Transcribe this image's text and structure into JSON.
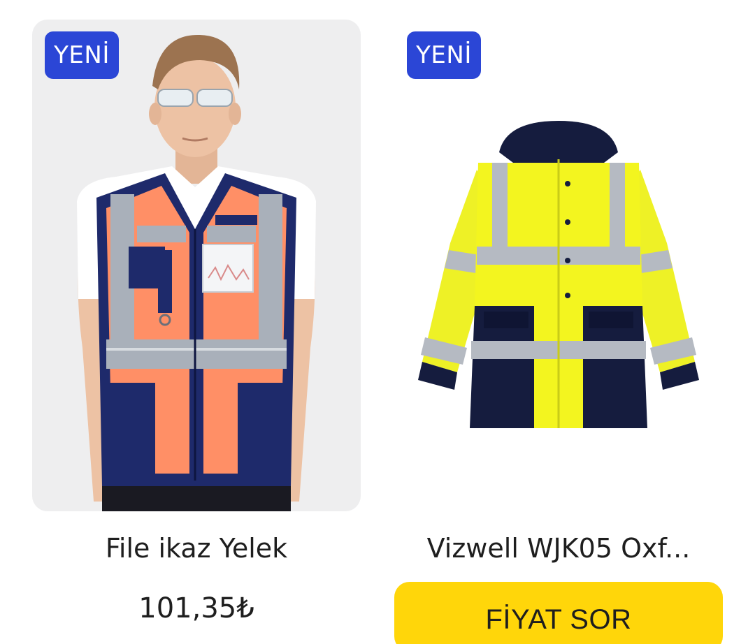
{
  "products": [
    {
      "badge": "YENİ",
      "image_icon": "reflective-vest-image",
      "name": "File ikaz Yelek",
      "price": "101,35₺"
    },
    {
      "badge": "YENİ",
      "image_icon": "hi-vis-jacket-image",
      "name": "Vizwell WJK05 Oxf...",
      "action_label": "FİYAT SOR"
    }
  ],
  "colors": {
    "badge_bg": "#2b46d6",
    "button_bg": "#ffd60a",
    "text": "#1e1e1e"
  }
}
